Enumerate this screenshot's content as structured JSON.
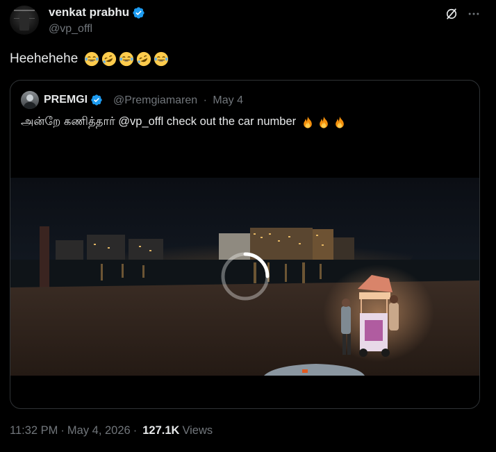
{
  "tweet": {
    "author_name": "venkat prabhu",
    "author_handle": "@vp_offl",
    "text": "Heehehehe",
    "emojis": [
      "face-with-tears-of-joy",
      "rolling-on-floor-laughing",
      "face-with-tears-of-joy",
      "rolling-on-floor-laughing",
      "face-with-tears-of-joy"
    ],
    "time": "11:32 PM",
    "separator": "·",
    "date": "May 4, 2026",
    "views_count": "127.1K",
    "views_label": "Views"
  },
  "quote": {
    "author_name": "PREMGI",
    "author_handle": "@Premgiamaren",
    "separator": "·",
    "date": "May 4",
    "text": "அன்றே கணித்தார் @vp_offl  check out the car number",
    "emojis": [
      "fire",
      "fire",
      "fire"
    ],
    "media": {
      "type": "video",
      "state": "loading",
      "description_icon": "loading-spinner-icon"
    }
  },
  "colors": {
    "background": "#000000",
    "text_primary": "#e7e9ea",
    "text_secondary": "#71767b",
    "border": "#2f3336",
    "verified_blue": "#1d9bf0"
  }
}
